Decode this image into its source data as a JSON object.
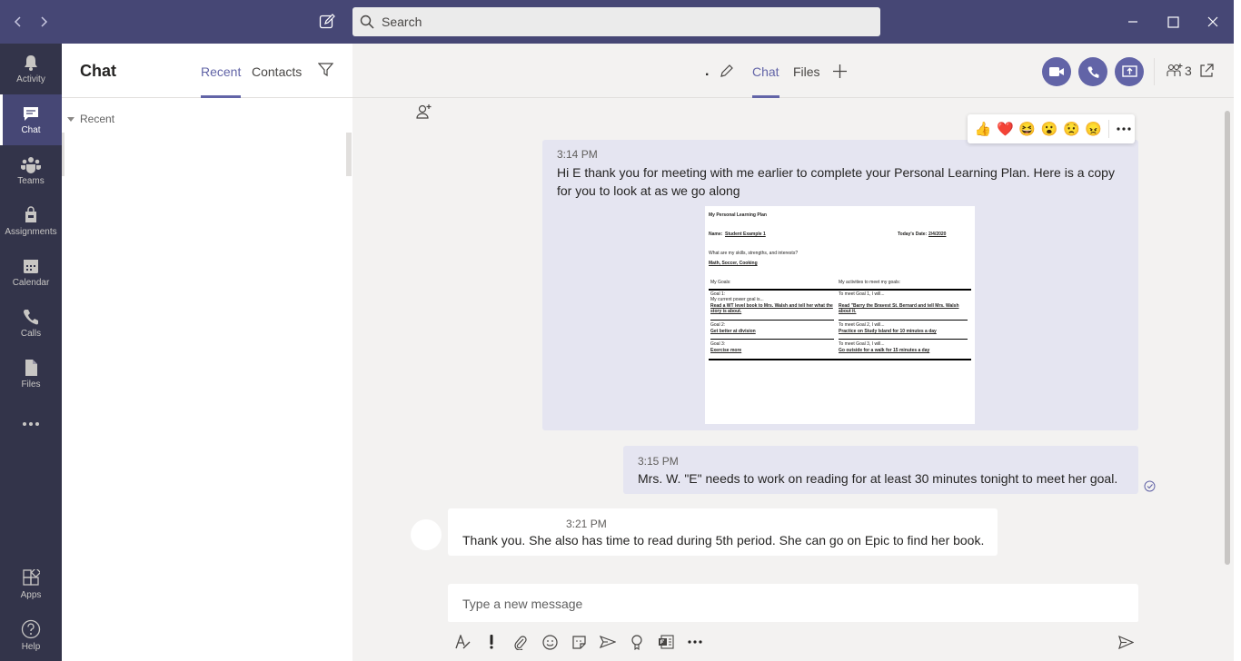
{
  "titlebar": {
    "search_placeholder": "Search",
    "bg_color": "#464775"
  },
  "rail": {
    "items": [
      {
        "label": "Activity",
        "icon": "bell-icon"
      },
      {
        "label": "Chat",
        "icon": "chat-icon",
        "active": true
      },
      {
        "label": "Teams",
        "icon": "teams-icon"
      },
      {
        "label": "Assignments",
        "icon": "assignments-icon"
      },
      {
        "label": "Calendar",
        "icon": "calendar-icon"
      },
      {
        "label": "Calls",
        "icon": "phone-icon"
      },
      {
        "label": "Files",
        "icon": "file-icon"
      },
      {
        "label": "...",
        "icon": "more-icon"
      },
      {
        "label": "Apps",
        "icon": "apps-icon"
      },
      {
        "label": "Help",
        "icon": "help-icon"
      }
    ]
  },
  "chat_list": {
    "title": "Chat",
    "tabs": [
      "Recent",
      "Contacts"
    ],
    "group_label": "Recent"
  },
  "chat_header": {
    "name": ".",
    "tabs": [
      "Chat",
      "Files"
    ],
    "participant_count": "3",
    "accent_color": "#6264a7"
  },
  "messages": [
    {
      "time": "3:14 PM",
      "text": "Hi E thank you for meeting with me earlier to complete your Personal Learning Plan.  Here is a copy for you to look at as we go along",
      "attachment": {
        "title": "My Personal Learning Plan",
        "name_label": "Name:",
        "name_value": "Student Example 1",
        "date_label": "Today's Date:",
        "date_value": "2/4/2020",
        "skills_q": "What are my skills, strengths, and interests?",
        "skills_a": "Math, Soccer, Cooking",
        "col1": "My Goals:",
        "col2": "My activities to meet my goals:",
        "rows": [
          {
            "g_label": "Goal 1:",
            "g_sub": "My current power goal is...",
            "g_val": "Read a WT level book to Mrs. Walsh and tell her what the story is about.",
            "a_label": "To meet Goal 1, I will...",
            "a_val": "Read \"Barry the Bravest St. Bernard and tell Mrs. Walsh about it."
          },
          {
            "g_label": "Goal 2:",
            "g_val": "Get better at division",
            "a_label": "To meet Goal 2, I will...",
            "a_val": "Practice on Study Island for 10 minutes a day"
          },
          {
            "g_label": "Goal 3:",
            "g_val": "Exercise more",
            "a_label": "To meet Goal 3, I will...",
            "a_val": "Go outside for a walk for 15 minutes a day"
          }
        ]
      }
    },
    {
      "time": "3:15 PM",
      "text": "Mrs. W. \"E\" needs to work on reading for at least 30 minutes tonight to meet her goal."
    },
    {
      "time": "3:21 PM",
      "text": "Thank you. She also has time to read during 5th period. She can go on Epic to find her book."
    }
  ],
  "reactions": [
    "👍",
    "❤️",
    "😆",
    "😮",
    "😟",
    "😠"
  ],
  "compose": {
    "placeholder": "Type a new message"
  }
}
